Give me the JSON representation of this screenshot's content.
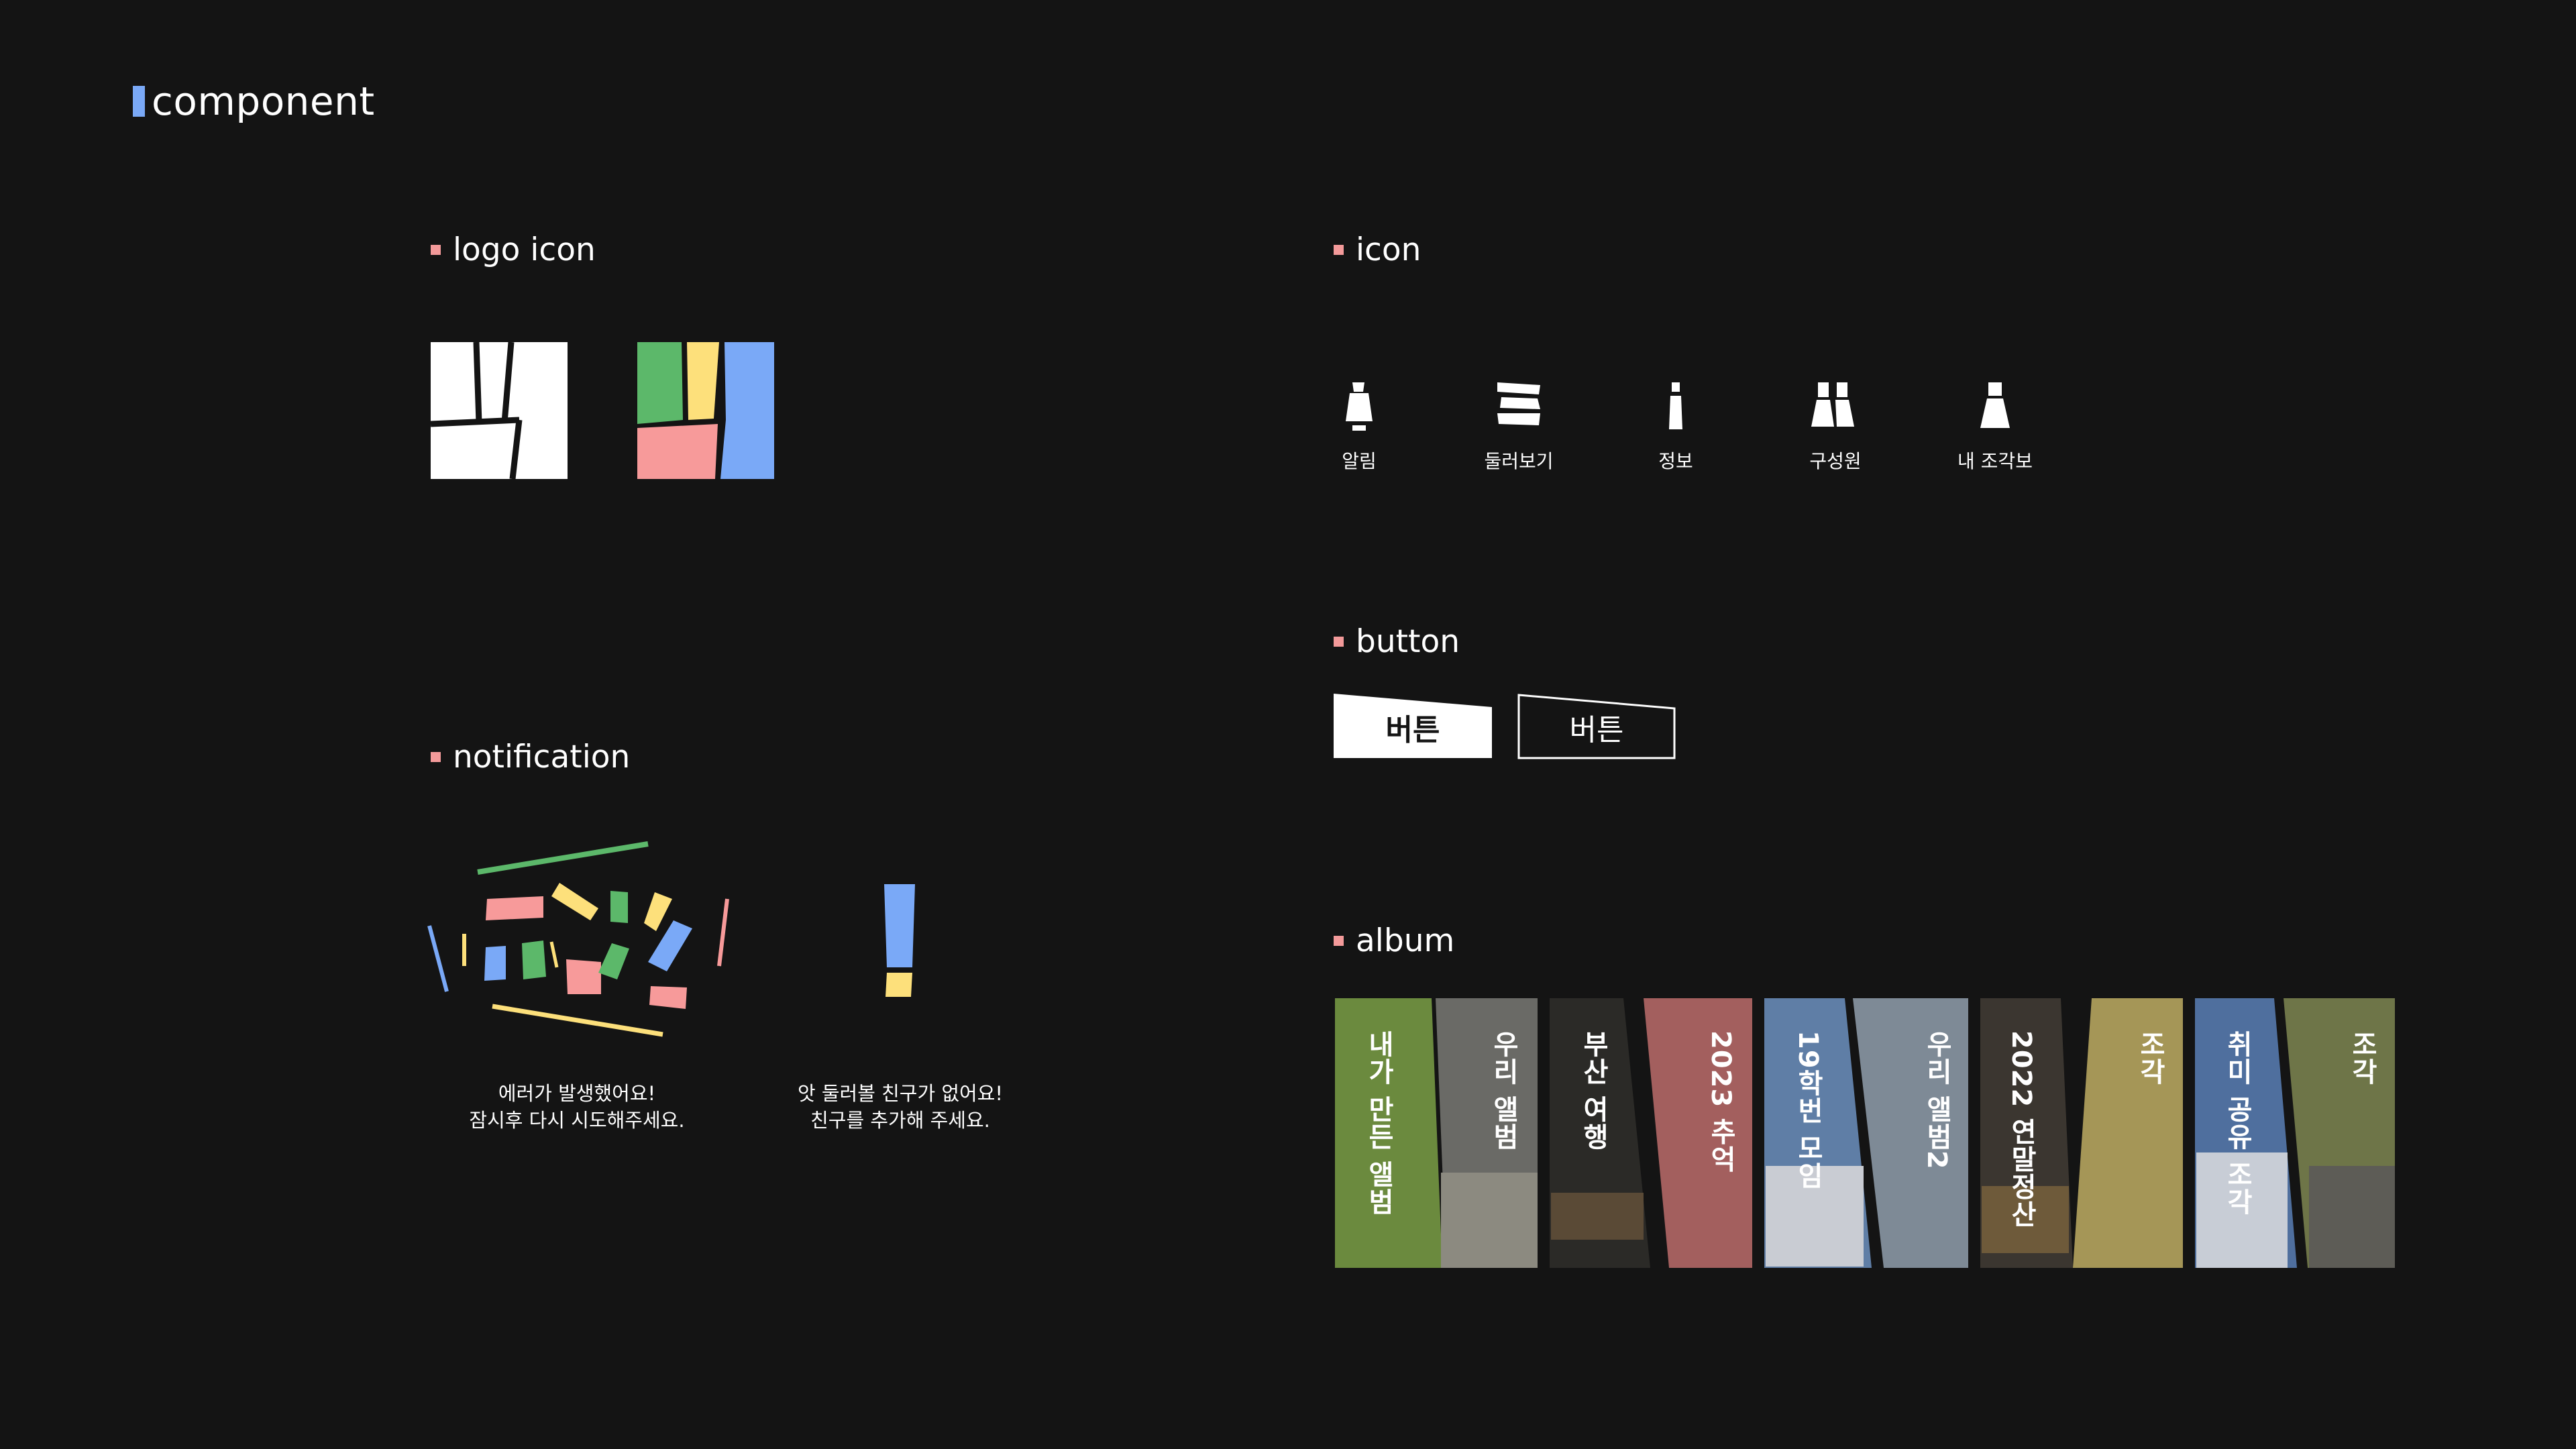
{
  "page": {
    "title": "component"
  },
  "sections": {
    "logo_icon": "logo icon",
    "icon": "icon",
    "button": "button",
    "notification": "notification",
    "album": "album"
  },
  "colors": {
    "background": "#141414",
    "accent_blue": "#7aa9f7",
    "accent_pink": "#f39a9a",
    "green": "#5cb86a",
    "yellow": "#fde07b",
    "pink": "#f79a9a",
    "blue": "#7aa9f7"
  },
  "icons": [
    {
      "name": "bell-icon",
      "label": "알림"
    },
    {
      "name": "browse-icon",
      "label": "둘러보기"
    },
    {
      "name": "info-icon",
      "label": "정보"
    },
    {
      "name": "members-icon",
      "label": "구성원"
    },
    {
      "name": "my-pieces-icon",
      "label": "내 조각보"
    }
  ],
  "buttons": {
    "filled_label": "버튼",
    "outline_label": "버튼"
  },
  "notifications": {
    "error_line1": "에러가 발생했어요!",
    "error_line2": "잠시후 다시 시도해주세요.",
    "empty_line1": "앗 둘러볼 친구가 없어요!",
    "empty_line2": "친구를 추가해 주세요."
  },
  "album": {
    "items": [
      {
        "label": "내가 만든 앨범",
        "color": "#6b8a3e"
      },
      {
        "label": "우리 앨범",
        "color": "#6a6a66"
      },
      {
        "label": "부산 여행",
        "color": "#2b2a27"
      },
      {
        "label": "2023 추억",
        "color": "#a35f5e"
      },
      {
        "label": "19학번 모임",
        "color": "#5f7ea6"
      },
      {
        "label": "우리 앨범2",
        "color": "#7e8a96"
      },
      {
        "label": "2022 연말정산",
        "color": "#3b3630"
      },
      {
        "label": "조각",
        "color": "#a59657"
      },
      {
        "label": "취미 공유 조각",
        "color": "#4f6f9e"
      },
      {
        "label": "조각",
        "color": "#6e7548"
      }
    ]
  }
}
